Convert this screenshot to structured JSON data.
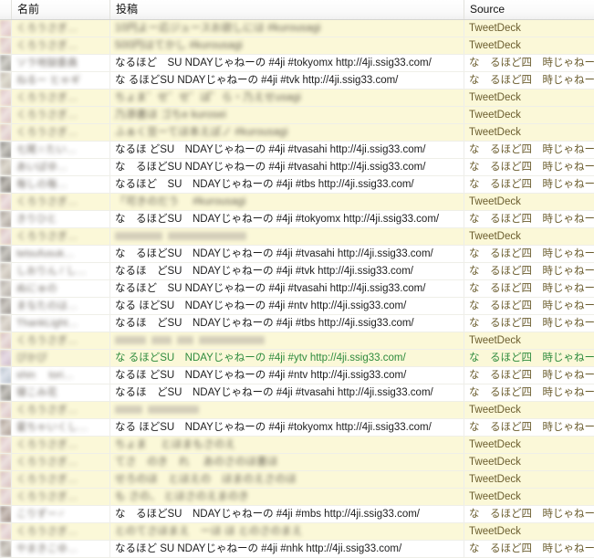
{
  "header": {
    "columns": [
      {
        "key": "gutter",
        "label": ""
      },
      {
        "key": "name",
        "label": "名前"
      },
      {
        "key": "post",
        "label": "投稿"
      },
      {
        "key": "source",
        "label": "Source"
      }
    ]
  },
  "colors": {
    "highlight_row": "#fbf8d8",
    "normal_row": "#ffffff",
    "source_text": "#6b5d2e",
    "green_text": "#2e8b3d",
    "grid_line": "#efefe8"
  },
  "sources": {
    "tweetdeck": "TweetDeck",
    "naruhodo": "な　るほど四　時じゃねーの"
  },
  "rows": [
    {
      "name": "",
      "post": "10円よー応ジュースお欲しには #kurousagi",
      "source": "TweetDeck",
      "redacted": true,
      "highlight": true,
      "green": false
    },
    {
      "name": "",
      "post": "500円はてかし #kurousagi",
      "source": "TweetDeck",
      "redacted": true,
      "highlight": true,
      "green": false
    },
    {
      "name": "",
      "post": "なるほど　SU NDAYじゃねーの #4ji #tokyomx http://4ji.ssig33.com/",
      "source": "な　るほど四　時じゃねーの",
      "redacted": false,
      "highlight": false,
      "green": false
    },
    {
      "name": "",
      "post": "な るほどSU NDAYじゃねーの #4ji #tvk http://4ji.ssig33.com/",
      "source": "な　るほど四　時じゃねーの",
      "redacted": false,
      "highlight": false,
      "green": false
    },
    {
      "name": "",
      "post": "ちょま゛せ゛せ゛ぽ゛ら・乃えせusagi",
      "source": "TweetDeck",
      "redacted": true,
      "highlight": true,
      "green": false
    },
    {
      "name": "",
      "post": "乃添書ほ ゴちe kurosei",
      "source": "TweetDeck",
      "redacted": true,
      "highlight": true,
      "green": false
    },
    {
      "name": "",
      "post": "ふぁく豆ーてほ本えぽノ #kurousagi",
      "source": "TweetDeck",
      "redacted": true,
      "highlight": true,
      "green": false
    },
    {
      "name": "",
      "post": "なるほ どSU　NDAYじゃねーの #4ji #tvasahi http://4ji.ssig33.com/",
      "source": "な　るほど四　時じゃねーの",
      "redacted": false,
      "highlight": false,
      "green": false
    },
    {
      "name": "",
      "post": "な　るほどSU NDAYじゃねーの #4ji #tvasahi http://4ji.ssig33.com/",
      "source": "な　るほど四　時じゃねーの",
      "redacted": false,
      "highlight": false,
      "green": false
    },
    {
      "name": "",
      "post": "なるほど　SU　NDAYじゃねーの #4ji #tbs http://4ji.ssig33.com/",
      "source": "な　るほど四　時じゃねーの",
      "redacted": false,
      "highlight": false,
      "green": false
    },
    {
      "name": "",
      "post": "「可きのだう　 #kurousagi",
      "source": "TweetDeck",
      "redacted": true,
      "highlight": true,
      "green": false
    },
    {
      "name": "",
      "post": "な　るほどSU　NDAYじゃねーの #4ji #tokyomx http://4ji.ssig33.com/",
      "source": "な　るほど四　時じゃねーの",
      "redacted": false,
      "highlight": false,
      "green": false
    },
    {
      "name": "",
      "post": "",
      "source": "TweetDeck",
      "redacted": true,
      "highlight": true,
      "green": false
    },
    {
      "name": "",
      "post": "な　るほどSU　NDAYじゃねーの #4ji #tvasahi http://4ji.ssig33.com/",
      "source": "な　るほど四　時じゃねーの",
      "redacted": false,
      "highlight": false,
      "green": false
    },
    {
      "name": "",
      "post": "なるほ　どSU　NDAYじゃねーの #4ji #tvk http://4ji.ssig33.com/",
      "source": "な　るほど四　時じゃねーの",
      "redacted": false,
      "highlight": false,
      "green": false
    },
    {
      "name": "",
      "post": "なるほど　SU NDAYじゃねーの #4ji #tvasahi http://4ji.ssig33.com/",
      "source": "な　るほど四　時じゃねーの",
      "redacted": false,
      "highlight": false,
      "green": false
    },
    {
      "name": "",
      "post": "なる ほどSU　NDAYじゃねーの #4ji #ntv http://4ji.ssig33.com/",
      "source": "な　るほど四　時じゃねーの",
      "redacted": false,
      "highlight": false,
      "green": false
    },
    {
      "name": "",
      "post": "なるほ　どSU　NDAYじゃねーの #4ji #tbs http://4ji.ssig33.com/",
      "source": "な　るほど四　時じゃねーの",
      "redacted": false,
      "highlight": false,
      "green": false
    },
    {
      "name": "",
      "post": "",
      "source": "TweetDeck",
      "redacted": true,
      "highlight": true,
      "green": false
    },
    {
      "name": "",
      "post": "な るほどSU　NDAYじゃねーの #4ji #ytv http://4ji.ssig33.com/",
      "source": "な　るほど四　時じゃねーの",
      "redacted": false,
      "highlight": true,
      "green": true
    },
    {
      "name": "",
      "post": "なるほ どSU　NDAYじゃねーの #4ji #ntv http://4ji.ssig33.com/",
      "source": "な　るほど四　時じゃねーの",
      "redacted": false,
      "highlight": false,
      "green": false
    },
    {
      "name": "",
      "post": "なるほ　どSU　NDAYじゃねーの #4ji #tvasahi http://4ji.ssig33.com/",
      "source": "な　るほど四　時じゃねーの",
      "redacted": false,
      "highlight": false,
      "green": false
    },
    {
      "name": "",
      "post": "",
      "source": "TweetDeck",
      "redacted": true,
      "highlight": true,
      "green": false
    },
    {
      "name": "",
      "post": "なる ほどSU　NDAYじゃねーの #4ji #tokyomx http://4ji.ssig33.com/",
      "source": "な　るほど四　時じゃねーの",
      "redacted": false,
      "highlight": false,
      "green": false
    },
    {
      "name": "",
      "post": "ちょま　 とほまもさのえ",
      "source": "TweetDeck",
      "redacted": true,
      "highlight": true,
      "green": false
    },
    {
      "name": "",
      "post": "てさ　のき　れ　 あのさのほ書ほ",
      "source": "TweetDeck",
      "redacted": true,
      "highlight": true,
      "green": false
    },
    {
      "name": "",
      "post": "せろのほ　とほえの　ほまのえさのほ",
      "source": "TweetDeck",
      "redacted": true,
      "highlight": true,
      "green": false
    },
    {
      "name": "",
      "post": "も さの、 とほさのえまのき",
      "source": "TweetDeck",
      "redacted": true,
      "highlight": true,
      "green": false
    },
    {
      "name": "",
      "post": "な　るほどSU　NDAYじゃねーの #4ji #mbs http://4ji.ssig33.com/",
      "source": "な　るほど四　時じゃねーの",
      "redacted": false,
      "highlight": false,
      "green": false
    },
    {
      "name": "",
      "post": "とのてさほまえ　ーほ ほ とのさのまえ",
      "source": "TweetDeck",
      "redacted": true,
      "highlight": true,
      "green": false
    },
    {
      "name": "",
      "post": "なるほど SU NDAYじゃねーの #4ji #nhk http://4ji.ssig33.com/",
      "source": "な　るほど四　時じゃねーの",
      "redacted": false,
      "highlight": false,
      "green": false
    }
  ]
}
